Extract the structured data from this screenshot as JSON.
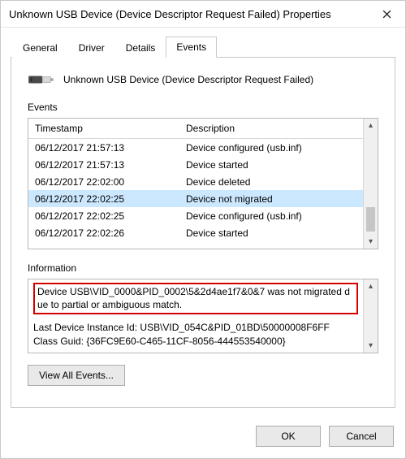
{
  "window": {
    "title": "Unknown USB Device (Device Descriptor Request Failed) Properties"
  },
  "tabs": {
    "general": "General",
    "driver": "Driver",
    "details": "Details",
    "events": "Events",
    "active": "events"
  },
  "device": {
    "name": "Unknown USB Device (Device Descriptor Request Failed)"
  },
  "events_section": {
    "label": "Events",
    "columns": {
      "timestamp": "Timestamp",
      "description": "Description"
    },
    "rows": [
      {
        "timestamp": "06/12/2017 21:57:13",
        "description": "Device configured (usb.inf)",
        "selected": false
      },
      {
        "timestamp": "06/12/2017 21:57:13",
        "description": "Device started",
        "selected": false
      },
      {
        "timestamp": "06/12/2017 22:02:00",
        "description": "Device deleted",
        "selected": false
      },
      {
        "timestamp": "06/12/2017 22:02:25",
        "description": "Device not migrated",
        "selected": true
      },
      {
        "timestamp": "06/12/2017 22:02:25",
        "description": "Device configured (usb.inf)",
        "selected": false
      },
      {
        "timestamp": "06/12/2017 22:02:26",
        "description": "Device started",
        "selected": false
      }
    ]
  },
  "information_section": {
    "label": "Information",
    "highlighted": "Device USB\\VID_0000&PID_0002\\5&2d4ae1f7&0&7 was not migrated due to partial or ambiguous match.",
    "details": "Last Device Instance Id: USB\\VID_054C&PID_01BD\\50000008F6FF\nClass Guid: {36FC9E60-C465-11CF-8056-444553540000}"
  },
  "buttons": {
    "view_all": "View All Events...",
    "ok": "OK",
    "cancel": "Cancel"
  }
}
